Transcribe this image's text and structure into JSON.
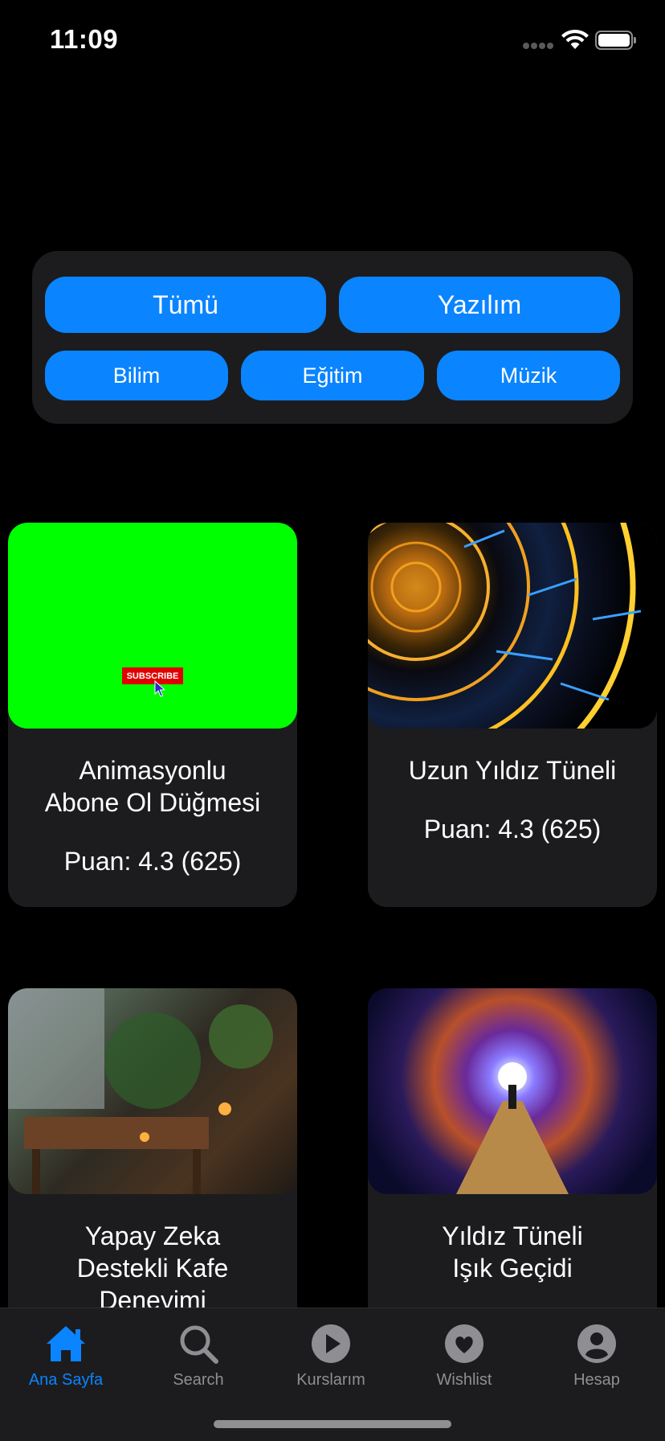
{
  "status": {
    "time": "11:09"
  },
  "filters": {
    "chips": [
      "Tümü",
      "Yazılım",
      "Bilim",
      "Eğitim",
      "Müzik"
    ]
  },
  "cards": [
    {
      "title_line1": "Animasyonlu",
      "title_line2": "Abone Ol Düğmesi",
      "rating": "Puan: 4.3 (625)",
      "thumb_badge": "SUBSCRIBE"
    },
    {
      "title_line1": "Uzun Yıldız Tüneli",
      "rating": "Puan: 4.3 (625)"
    },
    {
      "title_line1": "Yapay Zeka",
      "title_line2": "Destekli Kafe",
      "title_line3": "Deneyimi"
    },
    {
      "title_line1": "Yıldız Tüneli",
      "title_line2": "Işık Geçidi"
    }
  ],
  "tabbar": {
    "items": [
      {
        "label": "Ana Sayfa",
        "icon": "house-icon",
        "active": true
      },
      {
        "label": "Search",
        "icon": "magnifyingglass-icon"
      },
      {
        "label": "Kurslarım",
        "icon": "play-circle-icon"
      },
      {
        "label": "Wishlist",
        "icon": "heart-circle-icon"
      },
      {
        "label": "Hesap",
        "icon": "person-circle-icon"
      }
    ]
  },
  "colors": {
    "accent": "#0a84ff",
    "card_bg": "#1c1c1e",
    "background": "#000000"
  }
}
